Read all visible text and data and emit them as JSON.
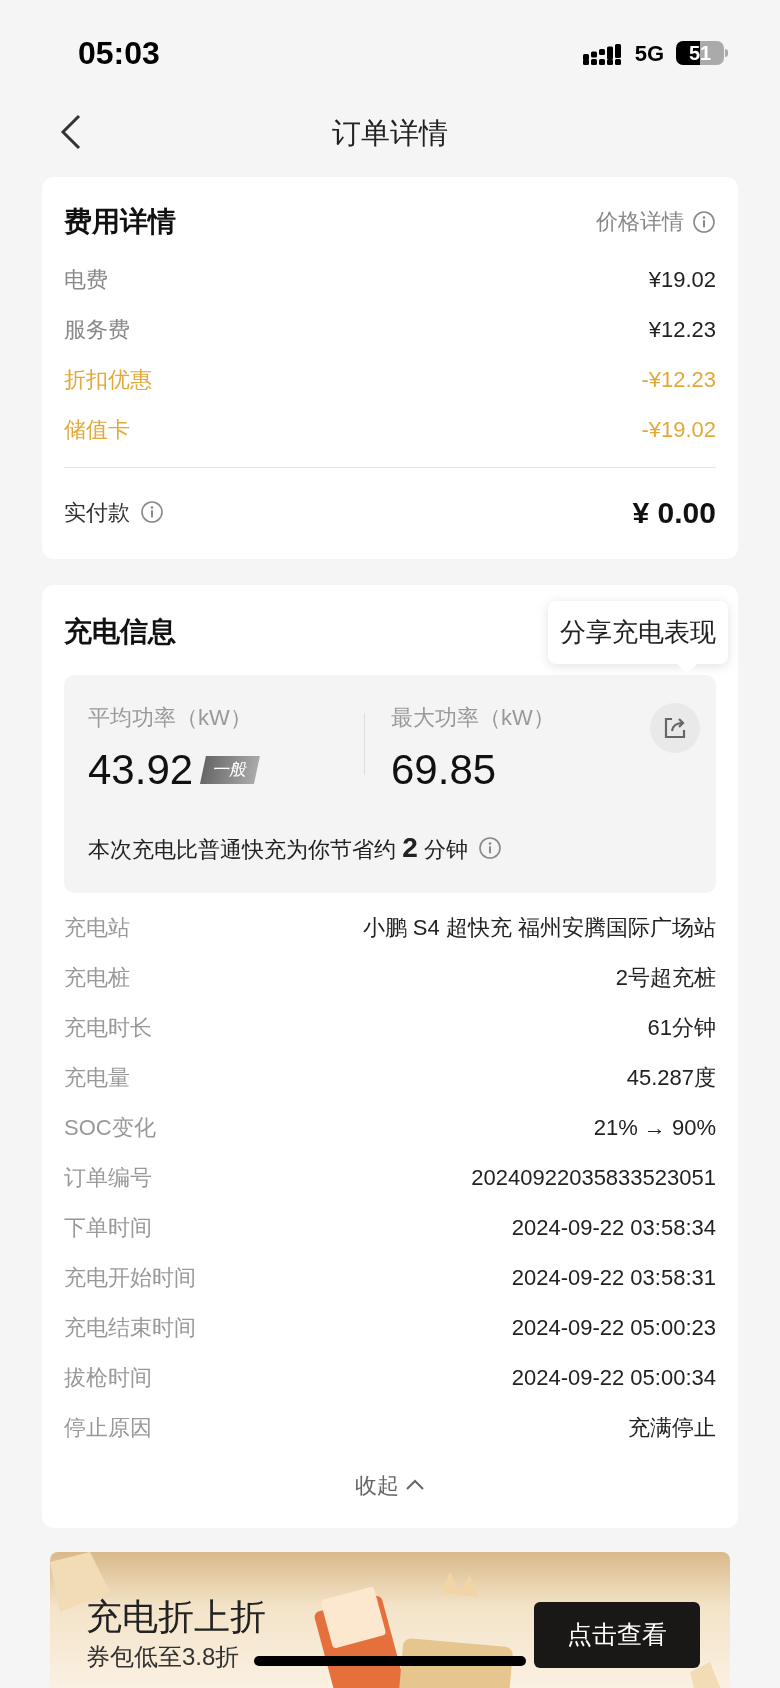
{
  "status_bar": {
    "time": "05:03",
    "network": "5G",
    "battery": "51"
  },
  "nav": {
    "title": "订单详情"
  },
  "fee_card": {
    "title": "费用详情",
    "link": "价格详情",
    "rows": [
      {
        "label": "电费",
        "value": "¥19.02",
        "kind": "normal"
      },
      {
        "label": "服务费",
        "value": "¥12.23",
        "kind": "normal"
      },
      {
        "label": "折扣优惠",
        "value": "-¥12.23",
        "kind": "discount"
      },
      {
        "label": "储值卡",
        "value": "-¥19.02",
        "kind": "discount"
      }
    ],
    "total": {
      "label": "实付款",
      "value": "¥ 0.00"
    }
  },
  "charge_card": {
    "title": "充电信息",
    "tooltip": "分享充电表现",
    "avg": {
      "label": "平均功率（kW）",
      "value": "43.92",
      "badge": "一般"
    },
    "max": {
      "label": "最大功率（kW）",
      "value": "69.85"
    },
    "saving": "本次充电比普通快充为你节省约 **2** 分钟",
    "rows": [
      {
        "label": "充电站",
        "value": "小鹏 S4 超快充 福州安腾国际广场站"
      },
      {
        "label": "充电桩",
        "value": "2号超充桩"
      },
      {
        "label": "充电时长",
        "value": "61分钟"
      },
      {
        "label": "充电量",
        "value": "45.287度"
      },
      {
        "label": "SOC变化",
        "value": "21% → 90%"
      },
      {
        "label": "订单编号",
        "value": "20240922035833523051"
      },
      {
        "label": "下单时间",
        "value": "2024-09-22 03:58:34"
      },
      {
        "label": "充电开始时间",
        "value": "2024-09-22 03:58:31"
      },
      {
        "label": "充电结束时间",
        "value": "2024-09-22 05:00:23"
      },
      {
        "label": "拔枪时间",
        "value": "2024-09-22 05:00:34"
      },
      {
        "label": "停止原因",
        "value": "充满停止"
      }
    ],
    "collapse": "收起"
  },
  "banner": {
    "title": "充电折上折",
    "subtitle": "券包低至3.8折",
    "button": "点击查看"
  }
}
